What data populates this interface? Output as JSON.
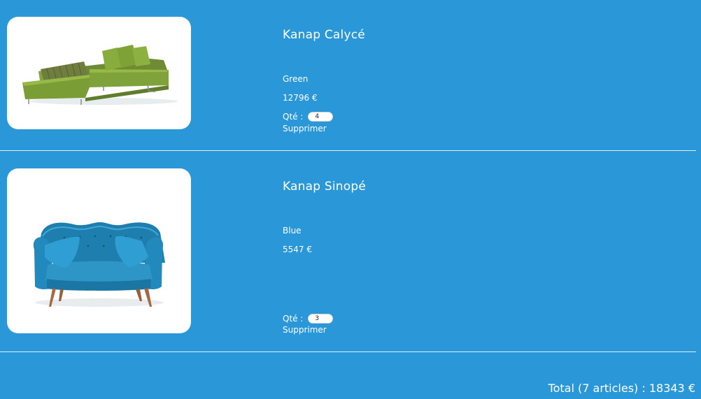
{
  "cart": {
    "items": [
      {
        "name": "Kanap Calycé",
        "color": "Green",
        "price": "12796 €",
        "quantity_label": "Qté :",
        "quantity": "4",
        "delete_label": "Supprimer",
        "image_alt": "green sectional sofa"
      },
      {
        "name": "Kanap Sinopé",
        "color": "Blue",
        "price": "5547 €",
        "quantity_label": "Qté :",
        "quantity": "3",
        "delete_label": "Supprimer",
        "image_alt": "blue tufted sofa"
      }
    ],
    "total": {
      "text": "Total (7 articles) : 18343 €",
      "article_count": 7,
      "amount": 18343
    }
  },
  "colors": {
    "page_background": "#2a98d8",
    "text": "#ffffff",
    "card_background": "#ffffff",
    "divider": "#ffffff"
  }
}
